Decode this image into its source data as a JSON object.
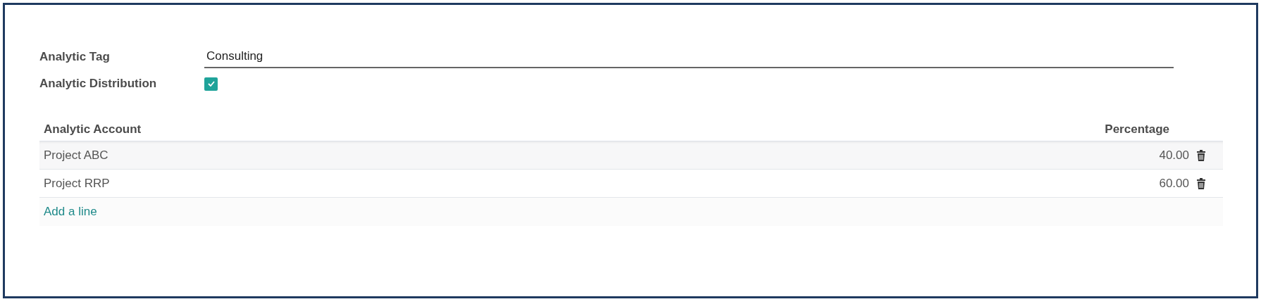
{
  "fields": [
    {
      "kind": "text",
      "label": "Analytic Tag",
      "value": "Consulting"
    },
    {
      "kind": "checkbox",
      "label": "Analytic Distribution",
      "checked": true
    }
  ],
  "table": {
    "columns": [
      "Analytic Account",
      "Percentage"
    ],
    "rows": [
      {
        "account": "Project ABC",
        "percentage": "40.00",
        "highlighted": true
      },
      {
        "account": "Project RRP",
        "percentage": "60.00",
        "highlighted": false
      }
    ],
    "add_line": "Add a line"
  }
}
